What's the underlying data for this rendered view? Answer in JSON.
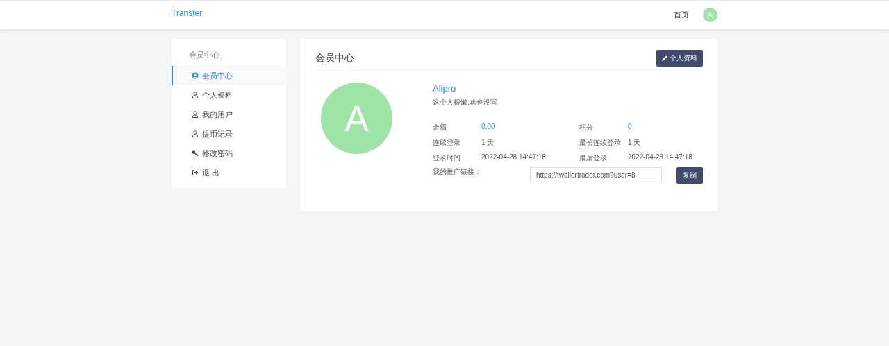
{
  "navbar": {
    "brand": "Transfer",
    "links": [
      {
        "label": "首页"
      }
    ],
    "avatar_letter": "A"
  },
  "sidebar": {
    "heading": "会员中心",
    "items": [
      {
        "label": "会员中心",
        "kind": "member",
        "selected": true
      },
      {
        "label": "个人资料",
        "kind": "user",
        "selected": false
      },
      {
        "label": "我的用户",
        "kind": "user",
        "selected": false
      },
      {
        "label": "提币记录",
        "kind": "user",
        "selected": false
      },
      {
        "label": "修改密码",
        "kind": "key",
        "selected": false
      },
      {
        "label": "退 出",
        "kind": "exit",
        "selected": false
      }
    ]
  },
  "panel": {
    "title": "会员中心",
    "edit_button": "个人资料",
    "avatar_letter": "A",
    "username": "Alipro",
    "bio": "这个人很懒,啥也没写",
    "stats": [
      {
        "label": "余额",
        "value": "0.00",
        "highlighted": true
      },
      {
        "label": "积分",
        "value": "0",
        "highlighted": true
      },
      {
        "label": "连续登录",
        "value": "1 天",
        "highlighted": false
      },
      {
        "label": "最长连续登录",
        "value": "1 天",
        "highlighted": false
      },
      {
        "label": "登录时间",
        "value": "2022-04-28 14:47:18",
        "highlighted": false
      },
      {
        "label": "最后登录",
        "value": "2022-04-28 14:47:18",
        "highlighted": false
      }
    ],
    "referral": {
      "label": "我的推广链接：",
      "value": "https://twallertrader.com?user=8",
      "button": "复制"
    }
  }
}
